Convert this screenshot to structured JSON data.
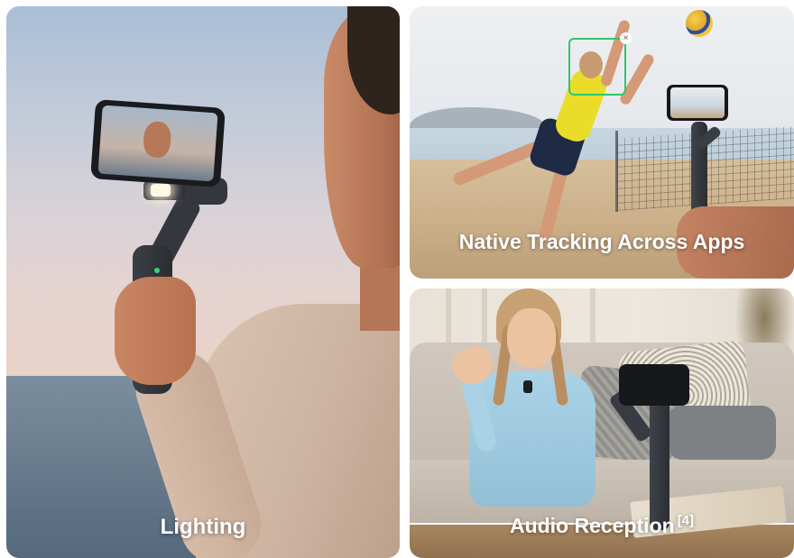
{
  "cards": {
    "lighting": {
      "caption": "Lighting"
    },
    "tracking": {
      "caption": "Native Tracking Across Apps",
      "tracking_box_close": "×"
    },
    "audio": {
      "caption": "Audio Reception",
      "footnote": "[4]"
    }
  },
  "colors": {
    "caption_text": "#ffffff",
    "tracking_box": "#2ec76a"
  }
}
